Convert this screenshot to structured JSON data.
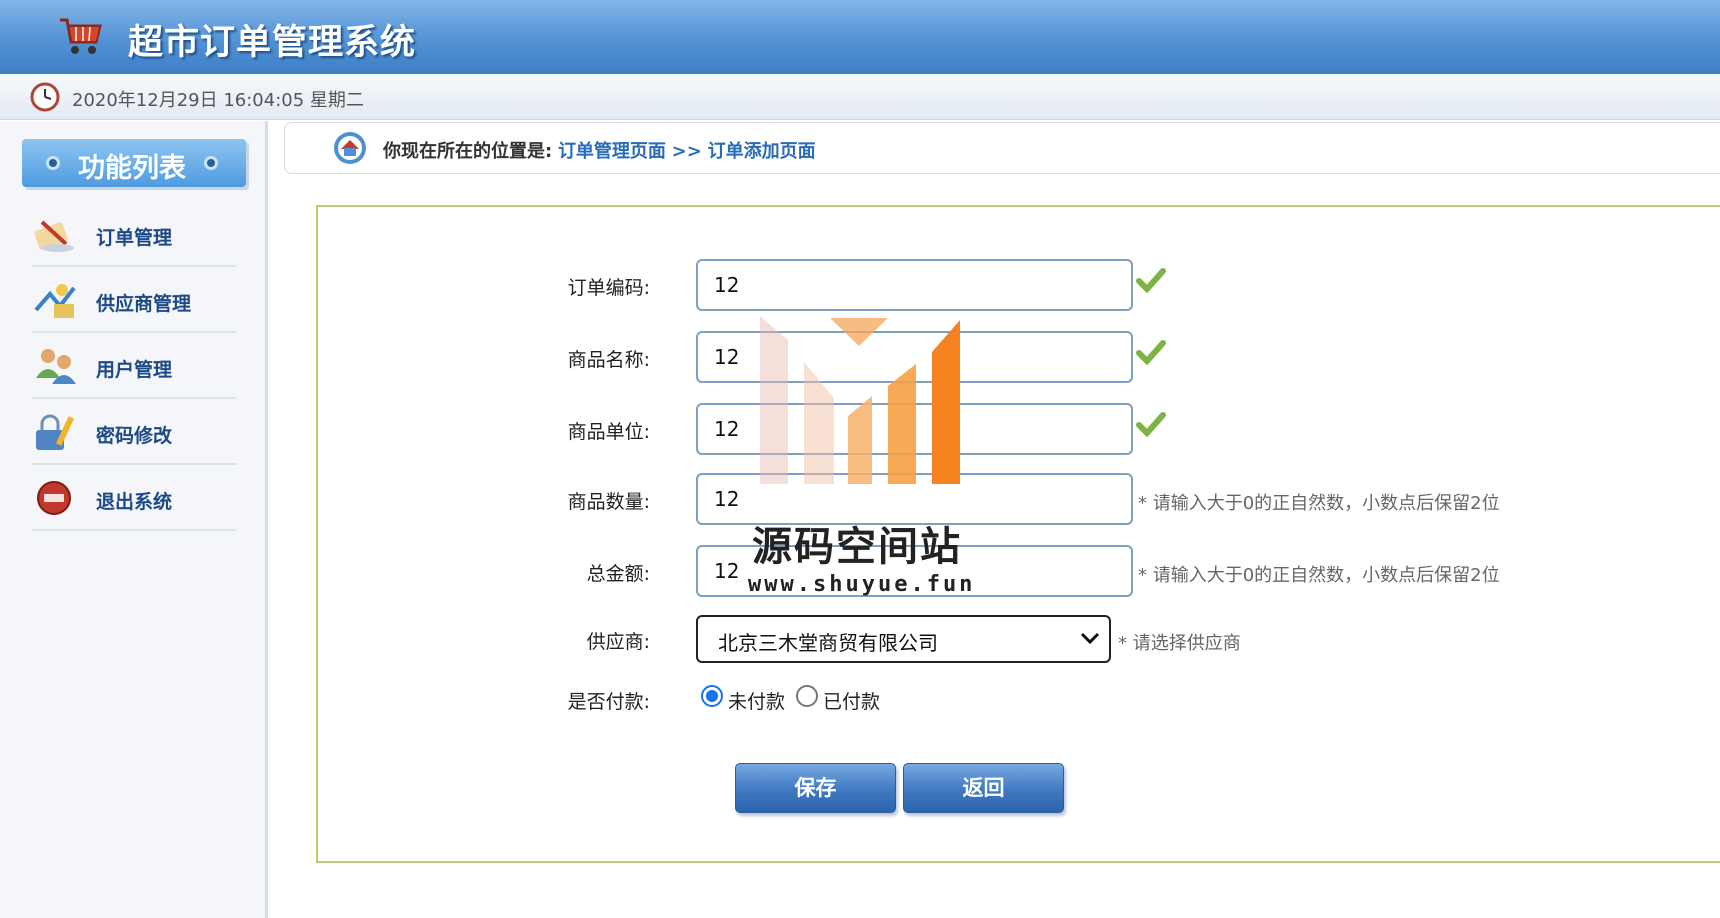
{
  "app": {
    "title": "超市订单管理系统"
  },
  "datebar": {
    "datetime": "2020年12月29日 16:04:05 星期二"
  },
  "sidebar": {
    "title": "功能列表",
    "items": [
      {
        "label": "订单管理",
        "icon": "order-icon"
      },
      {
        "label": "供应商管理",
        "icon": "supplier-icon"
      },
      {
        "label": "用户管理",
        "icon": "users-icon"
      },
      {
        "label": "密码修改",
        "icon": "password-icon"
      },
      {
        "label": "退出系统",
        "icon": "exit-icon"
      }
    ]
  },
  "breadcrumb": {
    "prefix": "你现在所在的位置是:",
    "page1": "订单管理页面",
    "sep": ">>",
    "page2": "订单添加页面"
  },
  "form": {
    "order_code": {
      "label": "订单编码:",
      "value": "12"
    },
    "product_name": {
      "label": "商品名称:",
      "value": "12"
    },
    "product_unit": {
      "label": "商品单位:",
      "value": "12"
    },
    "product_count": {
      "label": "商品数量:",
      "value": "12",
      "hint": "* 请输入大于0的正自然数，小数点后保留2位"
    },
    "total_price": {
      "label": "总金额:",
      "value": "12",
      "hint": "* 请输入大于0的正自然数，小数点后保留2位"
    },
    "provider": {
      "label": "供应商:",
      "value": "北京三木堂商贸有限公司",
      "hint": "* 请选择供应商"
    },
    "is_payment": {
      "label": "是否付款:",
      "options": [
        "未付款",
        "已付款"
      ],
      "selected": "未付款"
    },
    "save_label": "保存",
    "back_label": "返回"
  },
  "watermark": {
    "title": "源码空间站",
    "url": "www.shuyue.fun"
  }
}
